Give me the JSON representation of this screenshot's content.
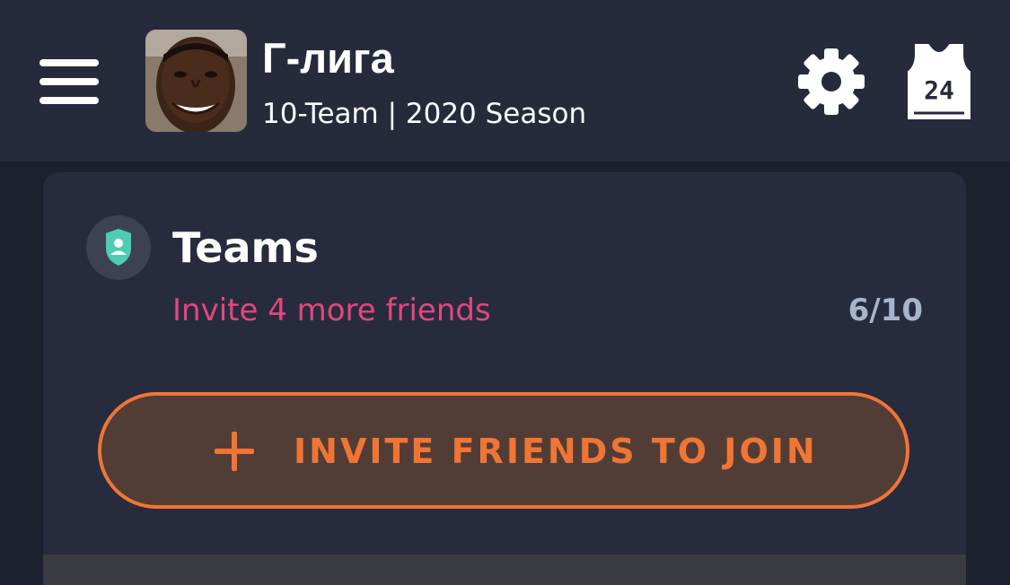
{
  "header": {
    "league_name": "Г-лига",
    "league_subtitle": "10-Team | 2020 Season",
    "menu_icon": "hamburger-menu-icon",
    "avatar_icon": "player-avatar",
    "settings_icon": "gear-icon",
    "jersey_icon": "jersey-icon",
    "jersey_number": "24"
  },
  "teams_card": {
    "title": "Teams",
    "icon": "shield-icon",
    "invite_status": "Invite 4 more friends",
    "count": "6/10",
    "invite_button_label": "INVITE FRIENDS TO JOIN",
    "invite_button_icon": "plus-icon"
  },
  "colors": {
    "background": "#1c2130",
    "header_bg": "#252b3b",
    "card_bg": "#262c3e",
    "accent_orange": "#f07535",
    "accent_pink": "#e2477c",
    "shield_teal": "#4ecdb5",
    "muted_text": "#a7b4cc"
  }
}
